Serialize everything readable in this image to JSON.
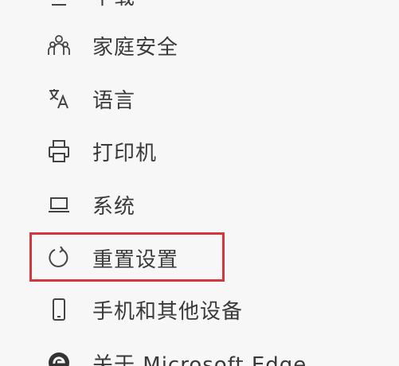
{
  "menu": {
    "items": [
      {
        "label": "下载",
        "icon": "download-icon"
      },
      {
        "label": "家庭安全",
        "icon": "family-icon"
      },
      {
        "label": "语言",
        "icon": "language-icon"
      },
      {
        "label": "打印机",
        "icon": "printer-icon"
      },
      {
        "label": "系统",
        "icon": "laptop-icon"
      },
      {
        "label": "重置设置",
        "icon": "reset-icon"
      },
      {
        "label": "手机和其他设备",
        "icon": "phone-icon"
      },
      {
        "label": "关于 Microsoft Edge",
        "icon": "edge-icon"
      }
    ]
  },
  "highlight": {
    "color": "#d2373d",
    "target": "重置设置"
  }
}
